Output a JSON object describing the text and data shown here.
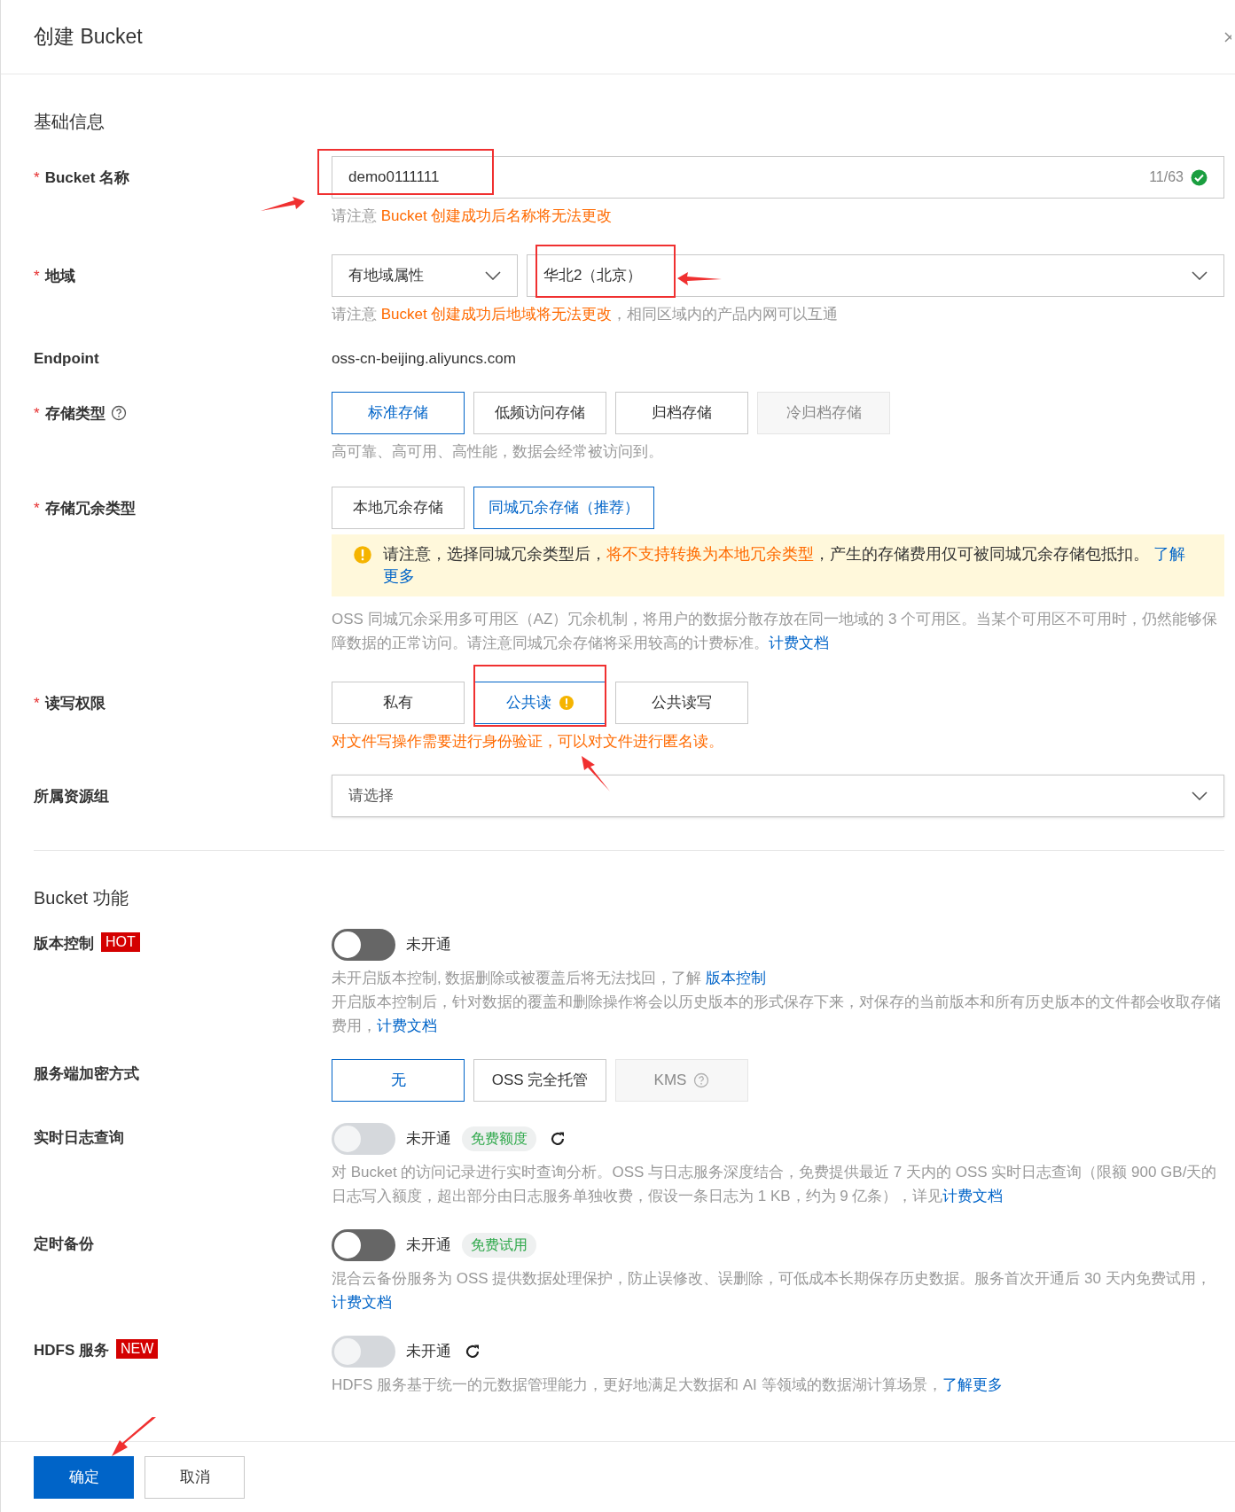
{
  "dialog": {
    "title": "创建 Bucket"
  },
  "basic_section": {
    "title": "基础信息"
  },
  "bucket_name": {
    "label": "Bucket 名称",
    "required_mark": "*",
    "value": "demo0111111",
    "counter": "11/63",
    "valid": true,
    "hint": [
      {
        "text": "请注意 ",
        "kind": "muted"
      },
      {
        "text": "Bucket 创建成功后名称将无法更改",
        "kind": "warn"
      }
    ]
  },
  "region": {
    "label": "地域",
    "required_mark": "*",
    "type_select": "有地域属性",
    "region_select": "华北2（北京）",
    "hint": [
      {
        "text": "请注意 ",
        "kind": "muted"
      },
      {
        "text": "Bucket 创建成功后地域将无法更改",
        "kind": "warn"
      },
      {
        "text": "，相同区域内的产品内网可以互通",
        "kind": "muted"
      }
    ]
  },
  "endpoint": {
    "label": "Endpoint",
    "value": "oss-cn-beijing.aliyuncs.com"
  },
  "storage_class": {
    "label": "存储类型",
    "required_mark": "*",
    "help": true,
    "options": [
      {
        "label": "标准存储",
        "selected": true,
        "disabled": false
      },
      {
        "label": "低频访问存储",
        "selected": false,
        "disabled": false
      },
      {
        "label": "归档存储",
        "selected": false,
        "disabled": false
      },
      {
        "label": "冷归档存储",
        "selected": false,
        "disabled": true
      }
    ],
    "hint": [
      {
        "text": "高可靠、高可用、高性能，数据会经常被访问到。",
        "kind": "muted"
      }
    ]
  },
  "redundancy": {
    "label": "存储冗余类型",
    "required_mark": "*",
    "options": [
      {
        "label": "本地冗余存储",
        "selected": false,
        "disabled": false
      },
      {
        "label": "同城冗余存储（推荐）",
        "selected": true,
        "disabled": false
      }
    ],
    "alert": [
      {
        "text": "请注意，选择同城冗余类型后，",
        "kind": "normal"
      },
      {
        "text": "将不支持转换为本地冗余类型",
        "kind": "warn"
      },
      {
        "text": "，产生的存储费用仅可被同城冗余存储包抵扣。 ",
        "kind": "normal"
      },
      {
        "text": "了解",
        "kind": "link"
      },
      {
        "text": "更多",
        "kind": "link"
      }
    ],
    "hint": [
      {
        "text": "OSS 同城冗余采用多可用区（AZ）冗余机制，将用户的数据分散存放在同一地域的 3 个可用区。当某个可用区不可用时，仍然能够保障数据的正常访问。请注意同城冗余存储将采用较高的计费标准。",
        "kind": "muted"
      },
      {
        "text": "计费文档",
        "kind": "link"
      }
    ]
  },
  "acl": {
    "label": "读写权限",
    "required_mark": "*",
    "options": [
      {
        "label": "私有",
        "selected": false,
        "disabled": false,
        "warning": false
      },
      {
        "label": "公共读",
        "selected": true,
        "disabled": false,
        "warning": true
      },
      {
        "label": "公共读写",
        "selected": false,
        "disabled": false,
        "warning": false
      }
    ],
    "hint": [
      {
        "text": "对文件写操作需要进行身份验证，可以对文件进行匿名读。",
        "kind": "warn"
      }
    ]
  },
  "resource_group": {
    "label": "所属资源组",
    "placeholder": "请选择"
  },
  "features_section": {
    "title": "Bucket 功能"
  },
  "features": [
    {
      "kind": "toggle",
      "label": "版本控制",
      "tag": "HOT",
      "on": false,
      "disabled": false,
      "status": "未开通",
      "lines": [
        [
          {
            "text": "未开启版本控制, 数据删除或被覆盖后将无法找回，了解 ",
            "kind": "muted"
          },
          {
            "text": "版本控制",
            "kind": "link"
          }
        ],
        [
          {
            "text": "开启版本控制后，针对数据的覆盖和删除操作将会以历史版本的形式保存下来，对保存的当前版本和所有历史版本的文件都会收取存储费用，",
            "kind": "muted"
          },
          {
            "text": "计费文档",
            "kind": "link"
          }
        ]
      ]
    },
    {
      "kind": "options",
      "label": "服务端加密方式",
      "options": [
        {
          "label": "无",
          "selected": true,
          "disabled": false,
          "help": false
        },
        {
          "label": "OSS 完全托管",
          "selected": false,
          "disabled": false,
          "help": false
        },
        {
          "label": "KMS",
          "selected": false,
          "disabled": true,
          "help": true
        }
      ]
    },
    {
      "kind": "toggle",
      "label": "实时日志查询",
      "on": false,
      "disabled": true,
      "status": "未开通",
      "badge": "免费额度",
      "refresh": true,
      "lines": [
        [
          {
            "text": "对 Bucket 的访问记录进行实时查询分析。OSS 与日志服务深度结合，免费提供最近 7 天内的 OSS 实时日志查询（限额 900 GB/天的日志写入额度，超出部分由日志服务单独收费，假设一条日志为 1 KB，约为 9 亿条），详见",
            "kind": "muted"
          },
          {
            "text": "计费文档",
            "kind": "link"
          }
        ]
      ]
    },
    {
      "kind": "toggle",
      "label": "定时备份",
      "on": false,
      "disabled": false,
      "status": "未开通",
      "badge": "免费试用",
      "lines": [
        [
          {
            "text": "混合云备份服务为 OSS 提供数据处理保护，防止误修改、误删除，可低成本长期保存历史数据。服务首次开通后 30 天内免费试用，",
            "kind": "muted"
          },
          {
            "text": "计费文档",
            "kind": "link"
          }
        ]
      ]
    },
    {
      "kind": "toggle",
      "label": "HDFS 服务",
      "tag": "NEW",
      "on": false,
      "disabled": true,
      "status": "未开通",
      "refresh": true,
      "lines": [
        [
          {
            "text": "HDFS 服务基于统一的元数据管理能力，更好地满足大数据和 AI 等领域的数据湖计算场景，",
            "kind": "muted"
          },
          {
            "text": "了解更多",
            "kind": "link"
          }
        ]
      ]
    }
  ],
  "footer": {
    "buttons": [
      {
        "label": "确定",
        "kind": "primary"
      },
      {
        "label": "取消",
        "kind": "secondary"
      }
    ]
  }
}
